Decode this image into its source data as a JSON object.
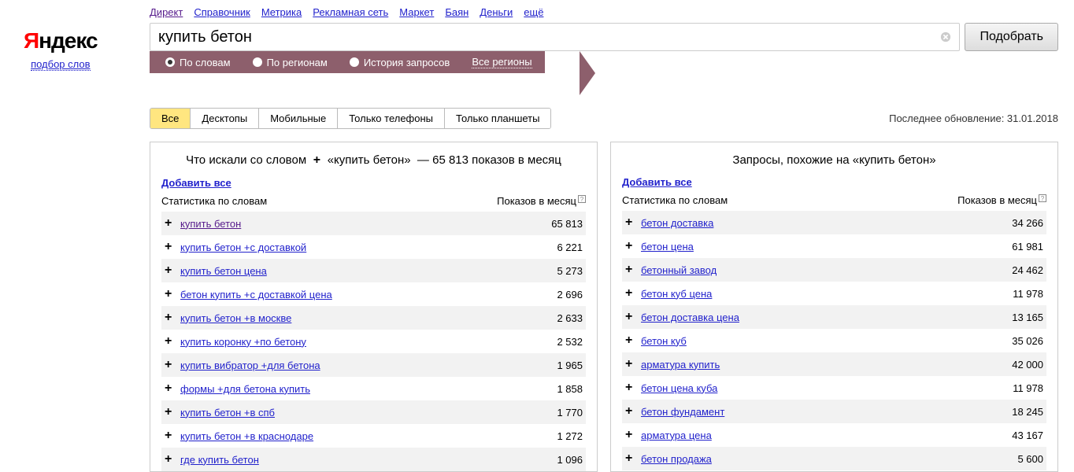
{
  "header_links": [
    "Директ",
    "Справочник",
    "Метрика",
    "Рекламная сеть",
    "Маркет",
    "Баян",
    "Деньги",
    "ещё"
  ],
  "logo": {
    "y": "Я",
    "rest": "ндекс",
    "sub": "подбор слов"
  },
  "search": {
    "value": "купить бетон",
    "submit": "Подобрать"
  },
  "filters": {
    "radios": [
      {
        "label": "По словам",
        "checked": true
      },
      {
        "label": "По регионам",
        "checked": false
      },
      {
        "label": "История запросов",
        "checked": false
      }
    ],
    "all_regions": "Все регионы"
  },
  "tabs": [
    "Все",
    "Десктопы",
    "Мобильные",
    "Только телефоны",
    "Только планшеты"
  ],
  "active_tab": 0,
  "update_info": "Последнее обновление: 31.01.2018",
  "add_all": "Добавить все",
  "stat_header": {
    "left": "Статистика по словам",
    "right": "Показов в месяц"
  },
  "left_panel": {
    "title_prefix": "Что искали со словом",
    "query": "«купить бетон»",
    "count_text": "65 813 показов в месяц",
    "rows": [
      {
        "text": "купить бетон",
        "value": "65 813",
        "visited": true
      },
      {
        "text": "купить бетон +с доставкой",
        "value": "6 221"
      },
      {
        "text": "купить бетон цена",
        "value": "5 273"
      },
      {
        "text": "бетон купить +с доставкой цена",
        "value": "2 696"
      },
      {
        "text": "купить бетон +в москве",
        "value": "2 633"
      },
      {
        "text": "купить коронку +по бетону",
        "value": "2 532"
      },
      {
        "text": "купить вибратор +для бетона",
        "value": "1 965"
      },
      {
        "text": "формы +для бетона купить",
        "value": "1 858"
      },
      {
        "text": "купить бетон +в спб",
        "value": "1 770"
      },
      {
        "text": "купить бетон +в краснодаре",
        "value": "1 272"
      },
      {
        "text": "где купить бетон",
        "value": "1 096"
      }
    ]
  },
  "right_panel": {
    "title": "Запросы, похожие на «купить бетон»",
    "rows": [
      {
        "text": "бетон доставка",
        "value": "34 266"
      },
      {
        "text": "бетон цена",
        "value": "61 981"
      },
      {
        "text": "бетонный завод",
        "value": "24 462"
      },
      {
        "text": "бетон куб цена",
        "value": "11 978"
      },
      {
        "text": "бетон доставка цена",
        "value": "13 165"
      },
      {
        "text": "бетон куб",
        "value": "35 026"
      },
      {
        "text": "арматура купить",
        "value": "42 000"
      },
      {
        "text": "бетон цена куба",
        "value": "11 978"
      },
      {
        "text": "бетон фундамент",
        "value": "18 245"
      },
      {
        "text": "арматура цена",
        "value": "43 167"
      },
      {
        "text": "бетон продажа",
        "value": "5 600"
      }
    ]
  }
}
